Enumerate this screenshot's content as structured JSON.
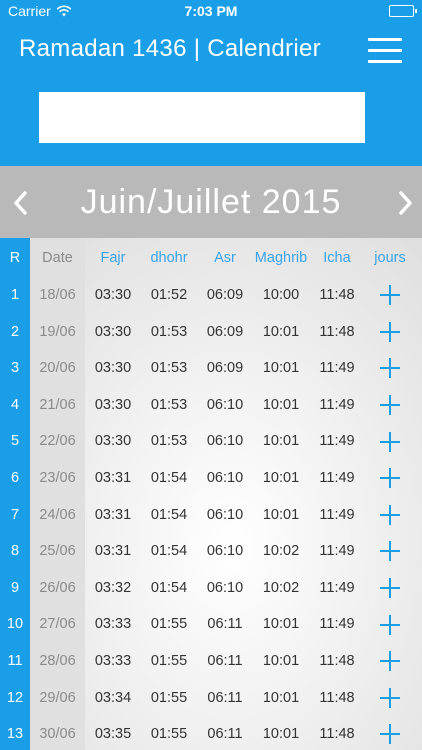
{
  "status_bar": {
    "carrier": "Carrier",
    "time": "7:03 PM"
  },
  "header": {
    "title": "Ramadan 1436 | Calendrier"
  },
  "month_nav": {
    "label": "Juin/Juillet 2015"
  },
  "columns": {
    "rank": "R",
    "date": "Date",
    "fajr": "Fajr",
    "dhohr": "dhohr",
    "asr": "Asr",
    "maghrib": "Maghrib",
    "icha": "Icha",
    "jours": "jours"
  },
  "rows": [
    {
      "r": "1",
      "date": "18/06",
      "fajr": "03:30",
      "dhohr": "01:52",
      "asr": "06:09",
      "maghrib": "10:00",
      "icha": "11:48"
    },
    {
      "r": "2",
      "date": "19/06",
      "fajr": "03:30",
      "dhohr": "01:53",
      "asr": "06:09",
      "maghrib": "10:01",
      "icha": "11:48"
    },
    {
      "r": "3",
      "date": "20/06",
      "fajr": "03:30",
      "dhohr": "01:53",
      "asr": "06:09",
      "maghrib": "10:01",
      "icha": "11:49"
    },
    {
      "r": "4",
      "date": "21/06",
      "fajr": "03:30",
      "dhohr": "01:53",
      "asr": "06:10",
      "maghrib": "10:01",
      "icha": "11:49"
    },
    {
      "r": "5",
      "date": "22/06",
      "fajr": "03:30",
      "dhohr": "01:53",
      "asr": "06:10",
      "maghrib": "10:01",
      "icha": "11:49"
    },
    {
      "r": "6",
      "date": "23/06",
      "fajr": "03:31",
      "dhohr": "01:54",
      "asr": "06:10",
      "maghrib": "10:01",
      "icha": "11:49"
    },
    {
      "r": "7",
      "date": "24/06",
      "fajr": "03:31",
      "dhohr": "01:54",
      "asr": "06:10",
      "maghrib": "10:01",
      "icha": "11:49"
    },
    {
      "r": "8",
      "date": "25/06",
      "fajr": "03:31",
      "dhohr": "01:54",
      "asr": "06:10",
      "maghrib": "10:02",
      "icha": "11:49"
    },
    {
      "r": "9",
      "date": "26/06",
      "fajr": "03:32",
      "dhohr": "01:54",
      "asr": "06:10",
      "maghrib": "10:02",
      "icha": "11:49"
    },
    {
      "r": "10",
      "date": "27/06",
      "fajr": "03:33",
      "dhohr": "01:55",
      "asr": "06:11",
      "maghrib": "10:01",
      "icha": "11:49"
    },
    {
      "r": "11",
      "date": "28/06",
      "fajr": "03:33",
      "dhohr": "01:55",
      "asr": "06:11",
      "maghrib": "10:01",
      "icha": "11:48"
    },
    {
      "r": "12",
      "date": "29/06",
      "fajr": "03:34",
      "dhohr": "01:55",
      "asr": "06:11",
      "maghrib": "10:01",
      "icha": "11:48"
    },
    {
      "r": "13",
      "date": "30/06",
      "fajr": "03:35",
      "dhohr": "01:55",
      "asr": "06:11",
      "maghrib": "10:01",
      "icha": "11:48"
    }
  ],
  "colors": {
    "accent": "#1a9ee8",
    "month_bar": "#b9b9b9",
    "header_text_blue": "#3aa4ea"
  },
  "icons": {
    "menu": "hamburger-menu-icon",
    "prev": "chevron-left-icon",
    "next": "chevron-right-icon",
    "add": "plus-icon"
  }
}
